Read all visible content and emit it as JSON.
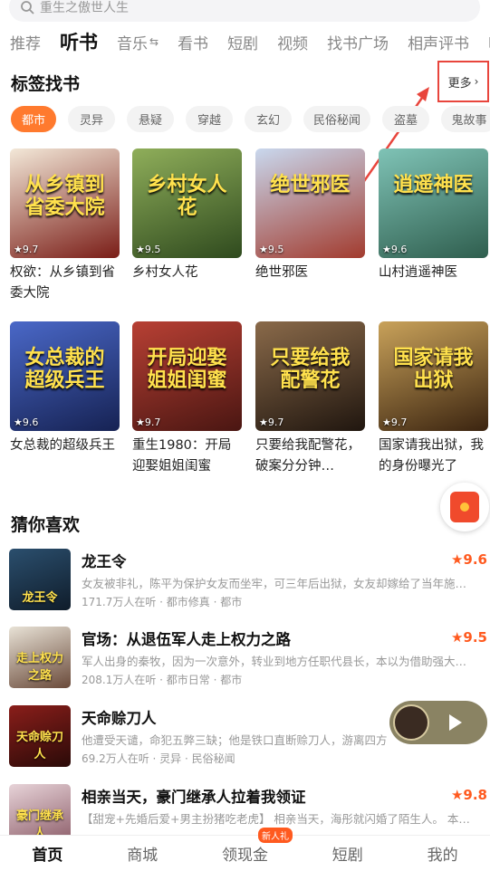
{
  "search": {
    "placeholder": "重生之傲世人生"
  },
  "category_tabs": [
    {
      "label": "推荐"
    },
    {
      "label": "听书",
      "active": true
    },
    {
      "label": "音乐",
      "swap": "⇆"
    },
    {
      "label": "看书"
    },
    {
      "label": "短剧"
    },
    {
      "label": "视频"
    },
    {
      "label": "找书广场"
    },
    {
      "label": "相声评书"
    },
    {
      "label": "听生"
    }
  ],
  "tag_section": {
    "title": "标签找书",
    "more_label": "更多",
    "chips": [
      "都市",
      "灵异",
      "悬疑",
      "穿越",
      "玄幻",
      "民俗秘闻",
      "盗墓",
      "鬼故事"
    ],
    "active_chip": "都市"
  },
  "books": [
    {
      "title": "权欲：从乡镇到省委大院",
      "rating": "9.7",
      "cover_text": "从乡镇到省委大院",
      "colors": [
        "#f3e8d8",
        "#7a1d17"
      ]
    },
    {
      "title": "乡村女人花",
      "rating": "9.5",
      "cover_text": "乡村女人花",
      "colors": [
        "#8fae5a",
        "#2f4a1e"
      ]
    },
    {
      "title": "绝世邪医",
      "rating": "9.5",
      "cover_text": "绝世邪医",
      "colors": [
        "#c9d8ee",
        "#a23b2e"
      ]
    },
    {
      "title": "山村逍遥神医",
      "rating": "9.6",
      "cover_text": "逍遥神医",
      "colors": [
        "#7fc3b6",
        "#2f5e4e"
      ]
    },
    {
      "title": "女总裁的超级兵王",
      "rating": "9.6",
      "cover_text": "女总裁的超级兵王",
      "colors": [
        "#4a68c8",
        "#162253"
      ]
    },
    {
      "title": "重生1980：开局迎娶姐姐闺蜜",
      "rating": "9.7",
      "cover_text": "开局迎娶姐姐闺蜜",
      "colors": [
        "#b84034",
        "#4a1612"
      ]
    },
    {
      "title": "只要给我配警花，破案分分钟…",
      "rating": "9.7",
      "cover_text": "只要给我配警花",
      "colors": [
        "#8a6a4a",
        "#20160f"
      ]
    },
    {
      "title": "国家请我出狱，我的身份曝光了",
      "rating": "9.7",
      "cover_text": "国家请我出狱",
      "colors": [
        "#c9a25a",
        "#3b2410"
      ]
    }
  ],
  "guess_section": {
    "title": "猜你喜欢",
    "items": [
      {
        "title": "龙王令",
        "score": "9.6",
        "desc": "女友被非礼，陈平为保护女友而坐牢，可三年后出狱，女友却嫁给了当年施…",
        "meta": "171.7万人在听 · 都市修真 · 都市",
        "thumb_text": "龙王令",
        "colors": [
          "#2b4f6e",
          "#0f1c2a"
        ]
      },
      {
        "title": "官场：从退伍军人走上权力之路",
        "score": "9.5",
        "desc": "军人出身的秦牧，因为一次意外，转业到地方任职代县长，本以为借助强大…",
        "meta": "208.1万人在听 · 都市日常 · 都市",
        "thumb_text": "走上权力之路",
        "colors": [
          "#e8e2d6",
          "#6a4a3a"
        ]
      },
      {
        "title": "天命赊刀人",
        "score": "",
        "desc": "他遭受天谴，命犯五弊三缺；他是铁口直断赊刀人，游离四方",
        "meta": "69.2万人在听 · 灵异 · 民俗秘闻",
        "thumb_text": "天命赊刀人",
        "colors": [
          "#8a1e1a",
          "#2a0a08"
        ]
      },
      {
        "title": "相亲当天，豪门继承人拉着我领证",
        "score": "9.8",
        "desc": "【甜宠+先婚后爱+男主扮猪吃老虎】 相亲当天，海彤就闪婚了陌生人。 本…",
        "meta": "",
        "thumb_text": "豪门继承人",
        "colors": [
          "#e7d3d8",
          "#8a5a66"
        ]
      }
    ]
  },
  "bottom_nav": [
    {
      "label": "首页",
      "active": true
    },
    {
      "label": "商城"
    },
    {
      "label": "领现金",
      "badge": "新人礼"
    },
    {
      "label": "短剧"
    },
    {
      "label": "我的"
    }
  ],
  "colors": {
    "accent": "#ff7a2e",
    "score": "#ff5a1f",
    "annotation": "#e8453c"
  }
}
